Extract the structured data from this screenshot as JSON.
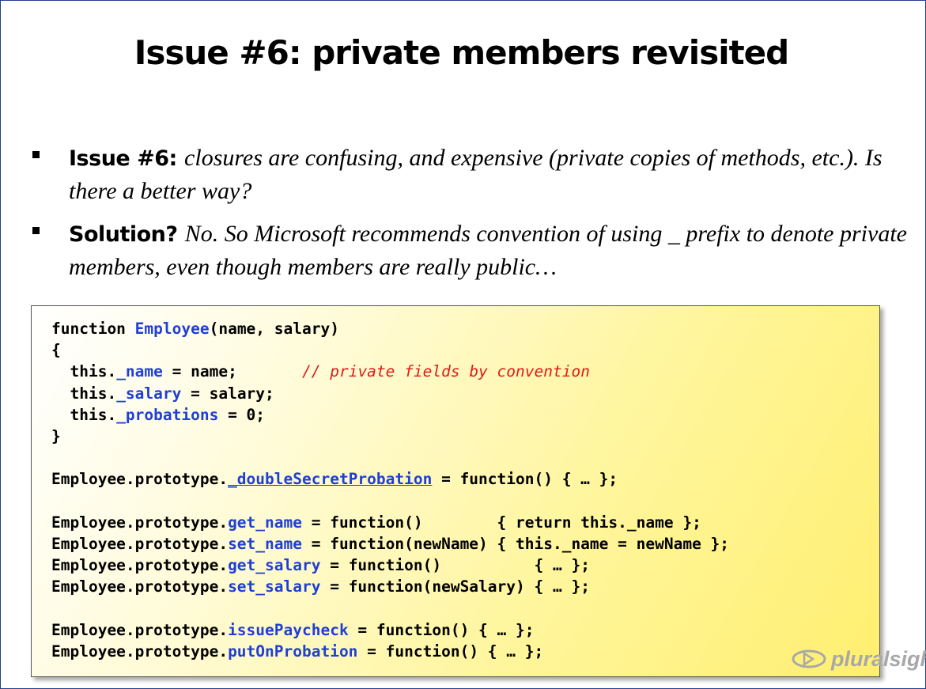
{
  "slide": {
    "title": "Issue #6:  private members revisited",
    "bullets": [
      {
        "lead": "Issue #6:",
        "text": "closures are confusing, and expensive (private copies of methods, etc.).  Is there a better way?"
      },
      {
        "lead": "Solution?",
        "text": "No.  So Microsoft recommends convention of using _ prefix to denote private members, even though members are really public…"
      }
    ]
  },
  "code": {
    "l1": {
      "a": "function ",
      "b": "Employee",
      "c": "(name, salary)"
    },
    "l2": "{",
    "l3": {
      "a": "  this.",
      "b": "_name",
      "c": " = name;       ",
      "d": "// private fields by convention"
    },
    "l4": {
      "a": "  this.",
      "b": "_salary",
      "c": " = salary;"
    },
    "l5": {
      "a": "  this.",
      "b": "_probations",
      "c": " = 0;"
    },
    "l6": "}",
    "l7": {
      "a": "Employee.prototype.",
      "b": "_doubleSecretProbation",
      "c": " = function() { … };"
    },
    "l8": {
      "a": "Employee.prototype.",
      "b": "get_name",
      "c": " = function()        { return this._name };"
    },
    "l9": {
      "a": "Employee.prototype.",
      "b": "set_name",
      "c": " = function(newName) { this._name = newName };"
    },
    "l10": {
      "a": "Employee.prototype.",
      "b": "get_salary",
      "c": " = function()          { … };"
    },
    "l11": {
      "a": "Employee.prototype.",
      "b": "set_salary",
      "c": " = function(newSalary) { … };"
    },
    "l12": {
      "a": "Employee.prototype.",
      "b": "issuePaycheck",
      "c": " = function() { … };"
    },
    "l13": {
      "a": "Employee.prototype.",
      "b": "putOnProbation",
      "c": " = function() { … };"
    }
  },
  "logo": {
    "text": "pluralsight",
    "icon": "pluralsight-eye-icon",
    "color": "#a8a8a8"
  },
  "colors": {
    "identifier_blue": "#1f3fd6",
    "comment_red": "#e01a1a",
    "code_bg": "#fff59a"
  }
}
